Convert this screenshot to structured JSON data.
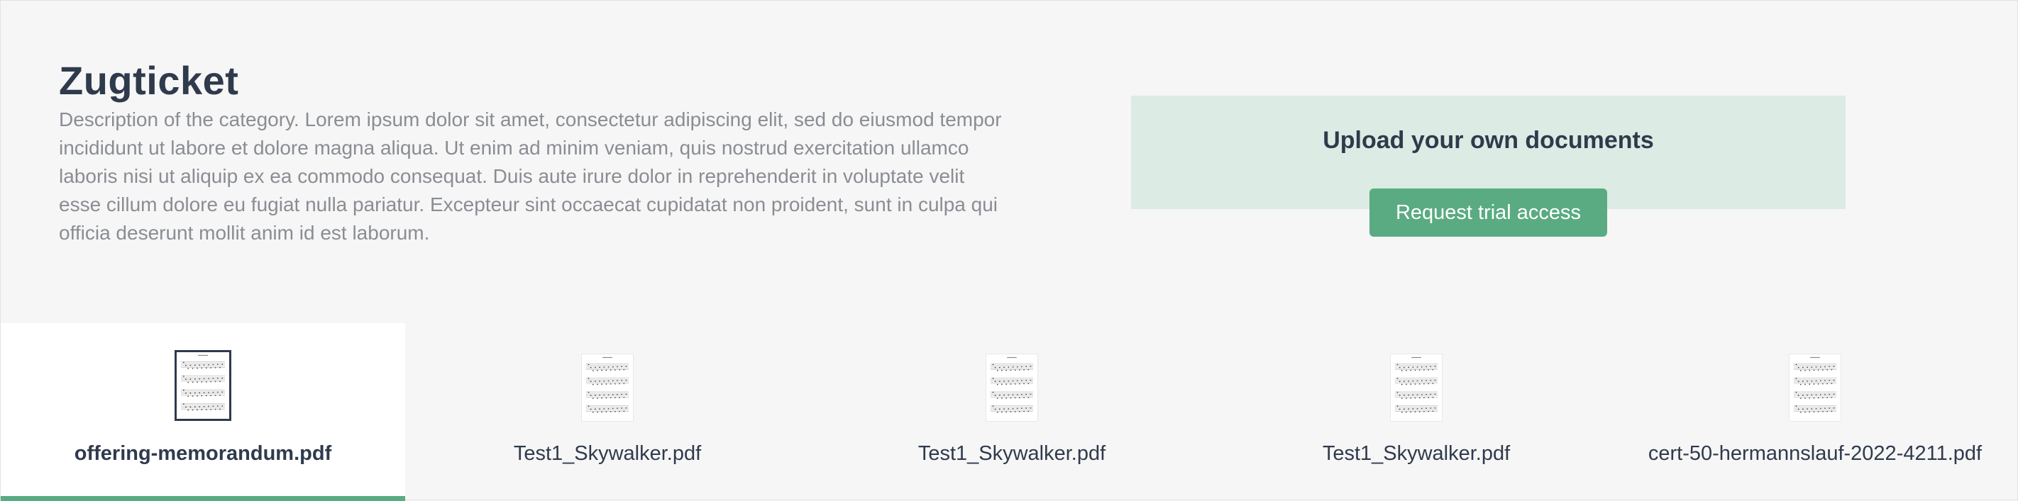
{
  "category": {
    "title": "Zugticket",
    "description": "Description of the category. Lorem ipsum dolor sit amet, consectetur adipiscing elit, sed do eiusmod tempor incididunt ut labore et dolore magna aliqua. Ut enim ad minim veniam, quis nostrud exercitation ullamco laboris nisi ut aliquip ex ea commodo consequat. Duis aute irure dolor in reprehenderit in voluptate velit esse cillum dolore eu fugiat nulla pariatur. Excepteur sint occaecat cupidatat non proident, sunt in culpa qui officia deserunt mollit anim id est laborum."
  },
  "upload": {
    "title": "Upload your own documents",
    "button_label": "Request trial access"
  },
  "documents": [
    {
      "name": "offering-memorandum.pdf",
      "selected": true
    },
    {
      "name": "Test1_Skywalker.pdf",
      "selected": false
    },
    {
      "name": "Test1_Skywalker.pdf",
      "selected": false
    },
    {
      "name": "Test1_Skywalker.pdf",
      "selected": false
    },
    {
      "name": "cert-50-hermannslauf-2022-4211.pdf",
      "selected": false
    }
  ],
  "colors": {
    "accent": "#5aab82",
    "upload_panel": "#dcebe3",
    "page_background": "#f6f6f6",
    "title_text": "#2f3a4c",
    "description_text": "#8a8d93"
  }
}
